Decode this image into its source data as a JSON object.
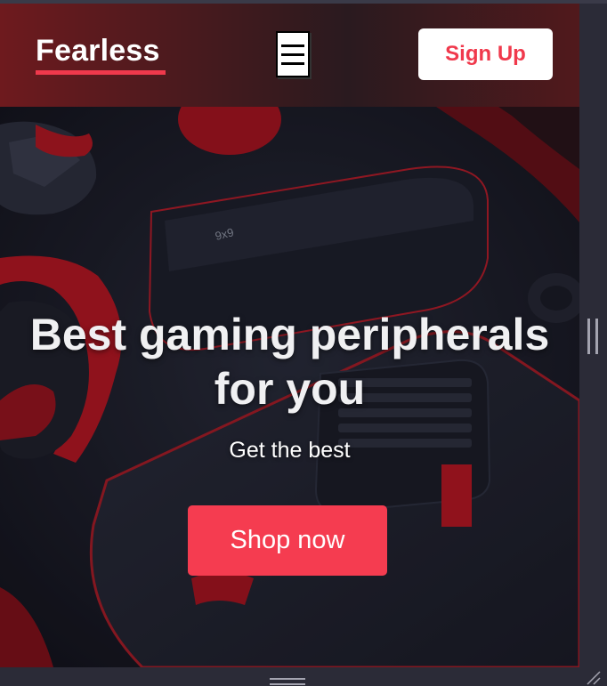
{
  "header": {
    "logo": "Fearless",
    "signup_label": "Sign Up",
    "menu_icon": "hamburger-menu-icon"
  },
  "hero": {
    "title": "Best gaming peripherals for you",
    "subtitle": "Get the best",
    "cta_label": "Shop now"
  },
  "colors": {
    "accent": "#f53c50",
    "header_left": "#6e1a1e",
    "header_right": "#51191c",
    "hero_bg": "#16161d"
  },
  "chrome": {
    "scrollbar_grip_icon": "vertical-grip-icon",
    "bottom_grip_icon": "horizontal-grip-icon",
    "resize_icon": "resize-corner-icon"
  }
}
